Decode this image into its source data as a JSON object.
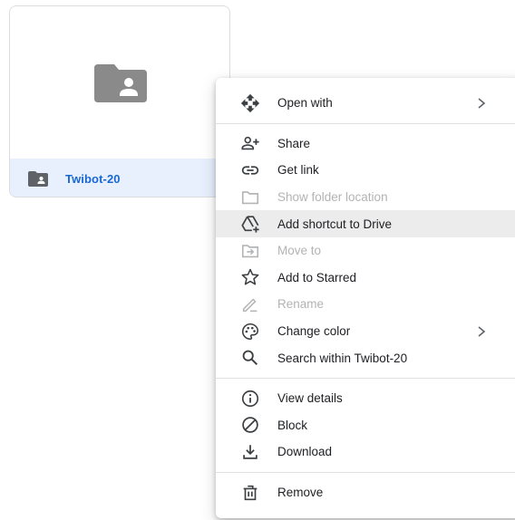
{
  "folder": {
    "name": "Twibot-20",
    "icon": "shared-folder-icon",
    "selected_bg": "#e8f0fe",
    "name_color": "#1967d2"
  },
  "menu": {
    "sections": [
      [
        {
          "id": "open-with",
          "label": "Open with",
          "icon": "open-with-icon",
          "submenu": true,
          "disabled": false
        }
      ],
      [
        {
          "id": "share",
          "label": "Share",
          "icon": "person-add-icon",
          "submenu": false,
          "disabled": false
        },
        {
          "id": "get-link",
          "label": "Get link",
          "icon": "link-icon",
          "submenu": false,
          "disabled": false
        },
        {
          "id": "show-folder-location",
          "label": "Show folder location",
          "icon": "folder-outline-icon",
          "submenu": false,
          "disabled": true
        },
        {
          "id": "add-shortcut",
          "label": "Add shortcut to Drive",
          "icon": "add-to-drive-icon",
          "submenu": false,
          "disabled": false,
          "highlighted": true
        },
        {
          "id": "move-to",
          "label": "Move to",
          "icon": "move-to-folder-icon",
          "submenu": false,
          "disabled": true
        },
        {
          "id": "add-to-starred",
          "label": "Add to Starred",
          "icon": "star-outline-icon",
          "submenu": false,
          "disabled": false
        },
        {
          "id": "rename",
          "label": "Rename",
          "icon": "pencil-icon",
          "submenu": false,
          "disabled": true
        },
        {
          "id": "change-color",
          "label": "Change color",
          "icon": "palette-icon",
          "submenu": true,
          "disabled": false
        },
        {
          "id": "search-within",
          "label": "Search within Twibot-20",
          "icon": "search-icon",
          "submenu": false,
          "disabled": false
        }
      ],
      [
        {
          "id": "view-details",
          "label": "View details",
          "icon": "info-icon",
          "submenu": false,
          "disabled": false
        },
        {
          "id": "block",
          "label": "Block",
          "icon": "block-icon",
          "submenu": false,
          "disabled": false
        },
        {
          "id": "download",
          "label": "Download",
          "icon": "download-icon",
          "submenu": false,
          "disabled": false
        }
      ],
      [
        {
          "id": "remove",
          "label": "Remove",
          "icon": "trash-icon",
          "submenu": false,
          "disabled": false
        }
      ]
    ],
    "chevron_icon": "chevron-right-icon",
    "highlight_color": "#ececec",
    "text_color": "#202124",
    "disabled_color": "#b3b3b3"
  }
}
